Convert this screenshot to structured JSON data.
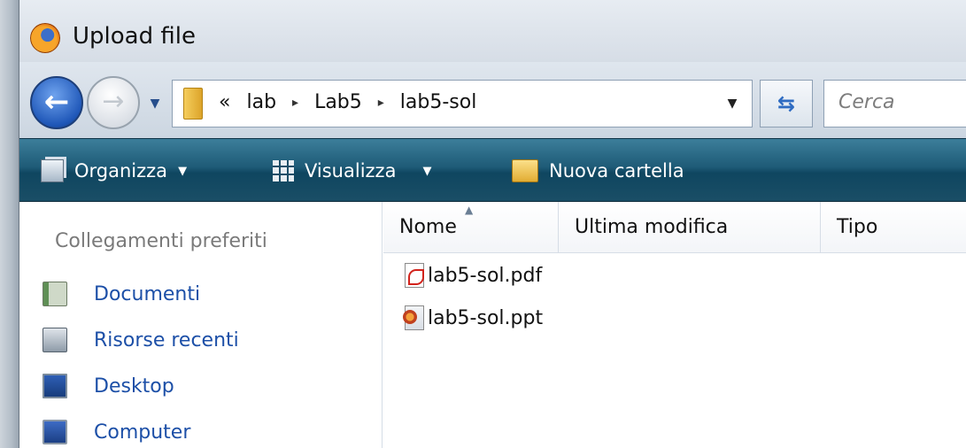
{
  "window": {
    "title": "Upload file",
    "icon": "firefox-icon"
  },
  "navigation": {
    "back_icon": "back-arrow-icon",
    "forward_icon": "forward-arrow-icon",
    "breadcrumb_prefix": "«",
    "breadcrumb": [
      "lab",
      "Lab5",
      "lab5-sol"
    ],
    "separator": "▸",
    "search_placeholder": "Cerca"
  },
  "toolbar": {
    "organize": "Organizza",
    "views": "Visualizza",
    "new_folder": "Nuova cartella"
  },
  "sidebar": {
    "heading": "Collegamenti preferiti",
    "items": [
      {
        "label": "Documenti",
        "icon": "documents-icon"
      },
      {
        "label": "Risorse recenti",
        "icon": "recent-places-icon"
      },
      {
        "label": "Desktop",
        "icon": "desktop-icon"
      },
      {
        "label": "Computer",
        "icon": "computer-icon"
      }
    ]
  },
  "file_list": {
    "columns": [
      "Nome",
      "Ultima modifica",
      "Tipo"
    ],
    "sorted_by": "Nome",
    "files": [
      {
        "name": "lab5-sol.pdf",
        "icon": "pdf-file-icon"
      },
      {
        "name": "lab5-sol.ppt",
        "icon": "powerpoint-file-icon"
      }
    ]
  },
  "colors": {
    "toolbar_bg": "#1e5b77",
    "link_blue": "#1c4fa7",
    "heading_gray": "#7a7a7a"
  }
}
